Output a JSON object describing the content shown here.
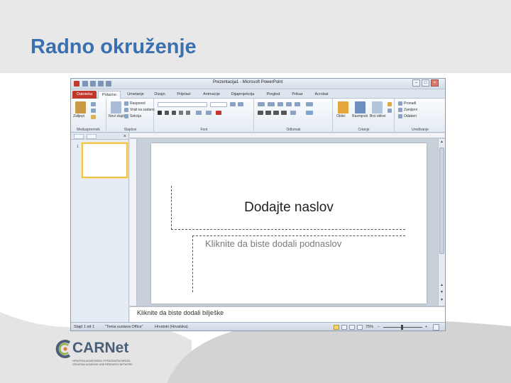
{
  "slide": {
    "title": "Radno okruženje"
  },
  "powerpoint": {
    "window_title": "Prezentacija1 - Microsoft PowerPoint",
    "tabs": [
      {
        "label": "Datoteka"
      },
      {
        "label": "Polazno"
      },
      {
        "label": "Umetanje"
      },
      {
        "label": "Dizajn"
      },
      {
        "label": "Prijelazi"
      },
      {
        "label": "Animacije"
      },
      {
        "label": "Dijaprojekcija"
      },
      {
        "label": "Pregled"
      },
      {
        "label": "Prikaz"
      },
      {
        "label": "Acrobat"
      }
    ],
    "ribbon": {
      "groups": [
        {
          "label": "Međuspremnik"
        },
        {
          "label": "Slajdovi"
        },
        {
          "label": "Font"
        },
        {
          "label": "Odlomak"
        },
        {
          "label": "Crtanje"
        },
        {
          "label": "Uređivanje"
        }
      ],
      "paste_label": "Zalijepi",
      "new_slide_label": "Novi slajd",
      "layout_label": "Raspored",
      "reset_label": "Vrati na zadano",
      "section_label": "Sekcija",
      "shapes_label": "Oblici",
      "arrange_label": "Razmjesti",
      "quick_styles_label": "Brzi stilovi",
      "find_label": "Pronađi",
      "replace_label": "Zamijeni",
      "select_label": "Odaberi"
    },
    "thumbnail": {
      "number": "1"
    },
    "slide_canvas": {
      "title_placeholder": "Dodajte naslov",
      "subtitle_placeholder": "Kliknite da biste dodali podnaslov"
    },
    "notes_placeholder": "Kliknite da biste dodali bilješke",
    "statusbar": {
      "slide_info": "Slajd 1 od 1",
      "theme": "\"Tema sustava Office\"",
      "language": "Hrvatski (Hrvatska)",
      "zoom": "75%"
    }
  },
  "logo": {
    "name": "CARNet",
    "subtitle_line1": "HRVATSKA AKADEMSKA I ISTRAŽIVAČKA MREŽA",
    "subtitle_line2": "CROATIAN ACADEMIC AND RESEARCH NETWORK"
  },
  "colors": {
    "title": "#3a6fb0",
    "file_tab": "#c2382b",
    "thumbnail_border": "#f2c34a"
  }
}
